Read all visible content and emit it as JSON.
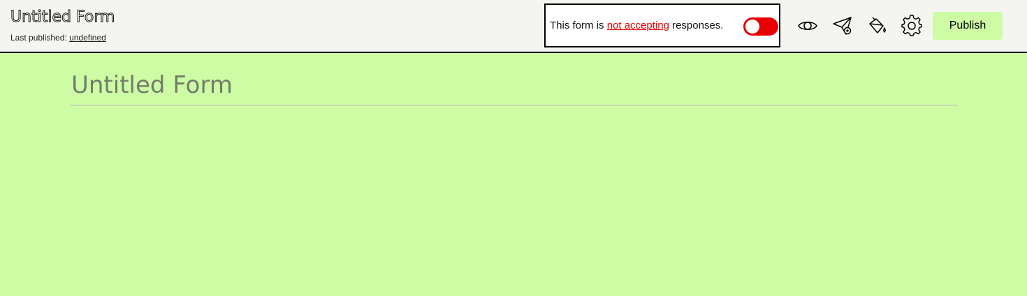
{
  "header": {
    "form_title": "Untitled Form",
    "last_published_label": "Last published:",
    "last_published_value": "undefined"
  },
  "status": {
    "prefix": "This form is",
    "state": "not accepting",
    "suffix": "responses.",
    "accepting": false,
    "toggle_color": "#e60000"
  },
  "toolbar": {
    "icons": [
      "eye-icon",
      "send-icon",
      "paint-bucket-icon",
      "gear-icon"
    ],
    "publish_label": "Publish"
  },
  "main": {
    "form_title": "Untitled Form"
  },
  "colors": {
    "background": "#cefca4",
    "topbar": "#f4f5f0",
    "accent": "#cefca4",
    "danger": "#e60000",
    "title_muted": "#737d6d"
  }
}
